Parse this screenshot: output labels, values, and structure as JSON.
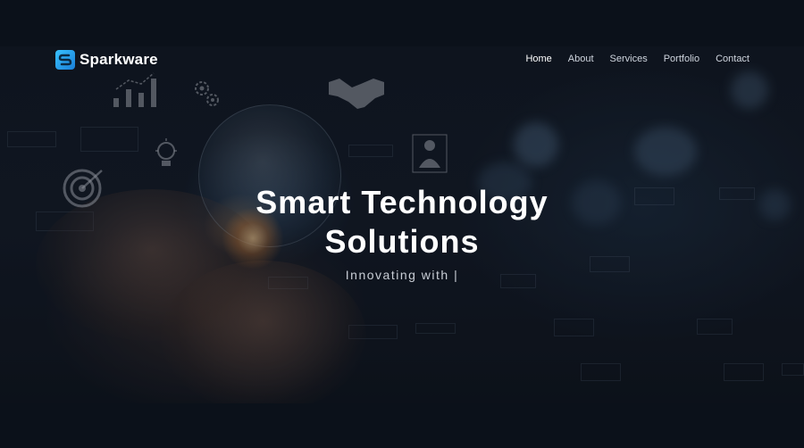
{
  "brand": {
    "name": "Sparkware",
    "logo_icon": "bolt-s-icon"
  },
  "nav": {
    "items": [
      {
        "label": "Home",
        "active": true
      },
      {
        "label": "About",
        "active": false
      },
      {
        "label": "Services",
        "active": false
      },
      {
        "label": "Portfolio",
        "active": false
      },
      {
        "label": "Contact",
        "active": false
      }
    ]
  },
  "hero": {
    "title_line1": "Smart Technology",
    "title_line2": "Solutions",
    "tagline": "Innovating with |",
    "decorative_icons": [
      "bar-chart-icon",
      "gears-icon",
      "handshake-icon",
      "lightbulb-icon",
      "target-icon",
      "businessman-icon",
      "globe-icon"
    ]
  },
  "colors": {
    "page_background": "#0b111a",
    "text_primary": "#ffffff",
    "logo_accent": "#38c2ff"
  }
}
